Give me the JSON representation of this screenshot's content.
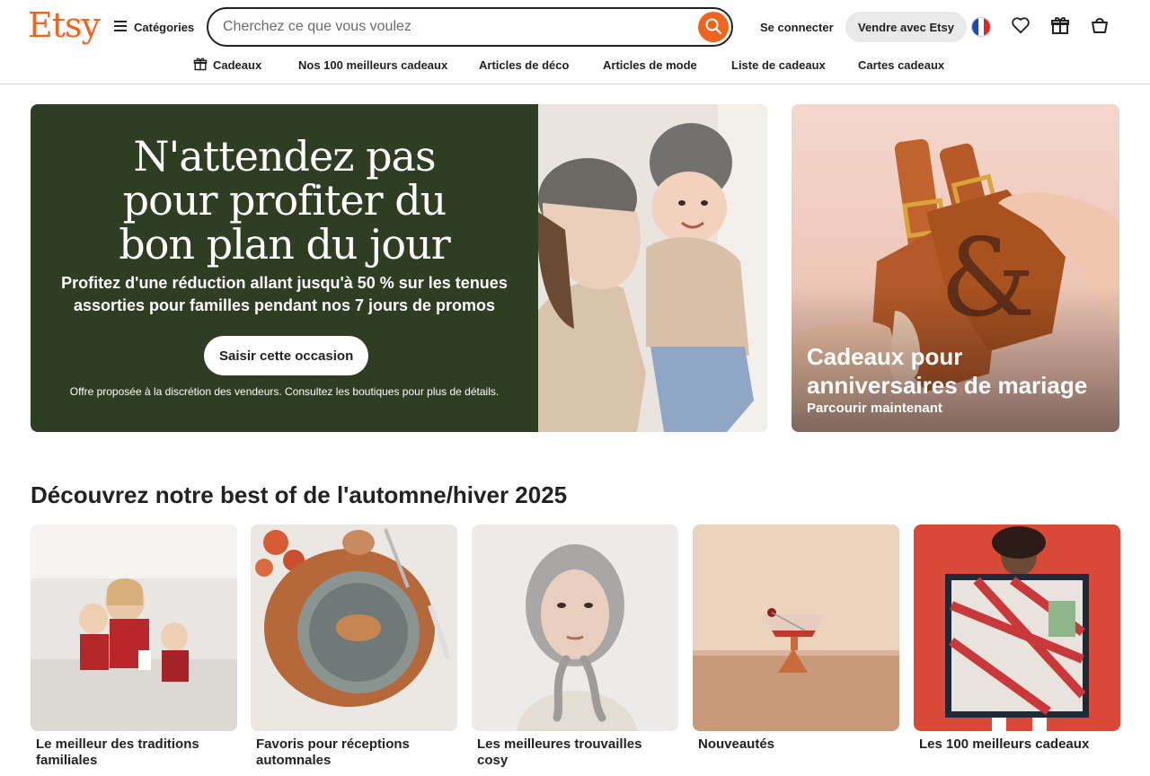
{
  "header": {
    "logo": "Etsy",
    "categories_label": "Catégories",
    "search_placeholder": "Cherchez ce que vous voulez",
    "signin_label": "Se connecter",
    "sell_label": "Vendre avec Etsy",
    "icons": [
      "menu-icon",
      "search-icon",
      "france-flag-icon",
      "heart-icon",
      "gift-icon",
      "cart-icon"
    ]
  },
  "subnav": [
    {
      "label": "Cadeaux",
      "icon": "gift-icon"
    },
    {
      "label": "Nos 100 meilleurs cadeaux"
    },
    {
      "label": "Articles de déco"
    },
    {
      "label": "Articles de mode"
    },
    {
      "label": "Liste de cadeaux"
    },
    {
      "label": "Cartes cadeaux"
    }
  ],
  "hero": {
    "title_lines": [
      "N'attendez pas",
      "pour profiter du",
      "bon plan du jour"
    ],
    "subtitle": "Profitez d'une réduction allant jusqu'à 50 % sur les tenues assorties pour familles pendant nos 7 jours de promos",
    "cta": "Saisir cette occasion",
    "note": "Offre proposée à la discrétion des vendeurs. Consultez les boutiques pour plus de détails."
  },
  "side_promo": {
    "title": "Cadeaux pour anniversaires de mariage",
    "link": "Parcourir maintenant"
  },
  "section": {
    "title": "Découvrez notre best of de l'automne/hiver 2025",
    "cards": [
      {
        "label": "Le meilleur des traditions familiales"
      },
      {
        "label": "Favoris pour réceptions automnales"
      },
      {
        "label": "Les meilleures trouvailles cosy"
      },
      {
        "label": "Nouveautés"
      },
      {
        "label": "Les 100 meilleurs cadeaux"
      }
    ]
  },
  "colors": {
    "brand": "#f1641e",
    "hero_bg": "#2f3d23",
    "text": "#222222"
  }
}
